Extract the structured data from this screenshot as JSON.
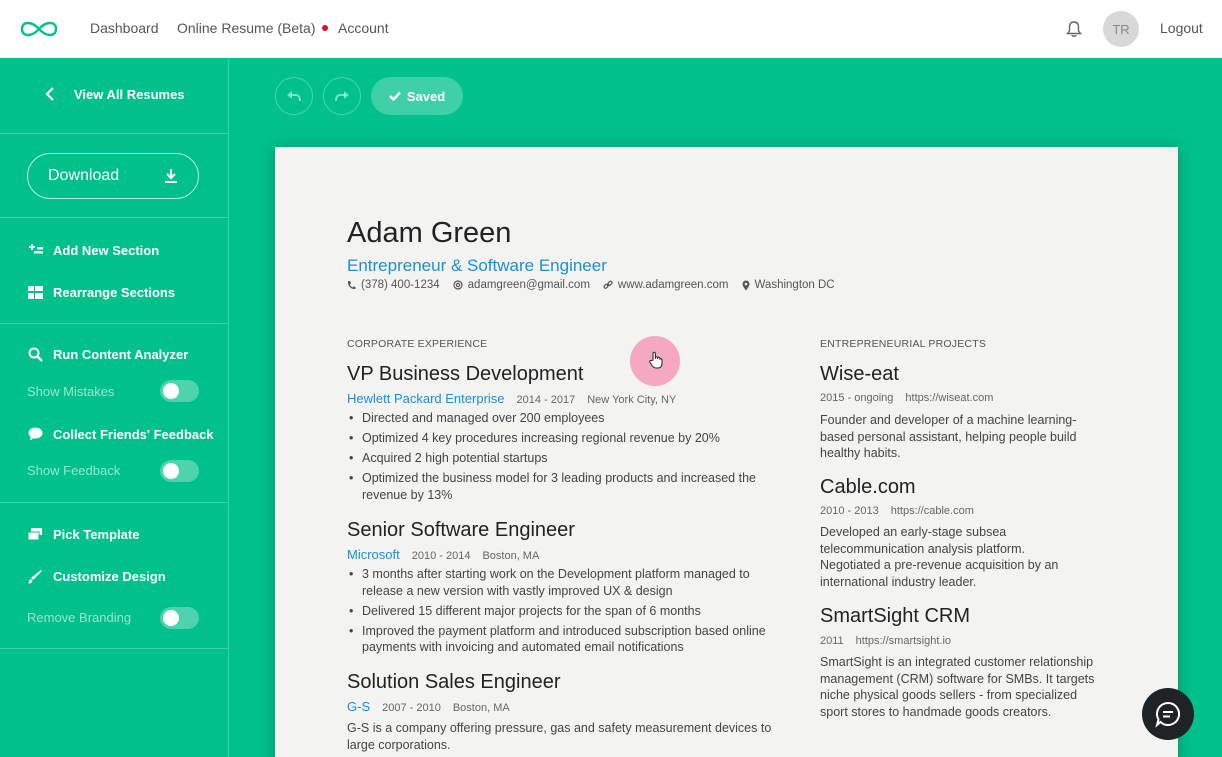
{
  "nav": {
    "dashboard": "Dashboard",
    "online_resume": "Online Resume (Beta)",
    "account": "Account",
    "avatar_initials": "TR",
    "logout": "Logout"
  },
  "sidebar": {
    "view_all": "View All Resumes",
    "download": "Download",
    "add_section": "Add New Section",
    "rearrange": "Rearrange Sections",
    "run_analyzer": "Run Content Analyzer",
    "show_mistakes": "Show Mistakes",
    "collect_feedback": "Collect Friends' Feedback",
    "show_feedback": "Show Feedback",
    "pick_template": "Pick Template",
    "customize_design": "Customize Design",
    "remove_branding": "Remove Branding"
  },
  "toolbar": {
    "saved": "Saved"
  },
  "resume": {
    "name": "Adam Green",
    "title": "Entrepreneur & Software Engineer",
    "phone": "(378) 400-1234",
    "email": "adamgreen@gmail.com",
    "website": "www.adamgreen.com",
    "location": "Washington DC",
    "corporate_heading": "CORPORATE EXPERIENCE",
    "entrepreneurial_heading": "ENTREPRENEURIAL PROJECTS",
    "jobs": [
      {
        "title": "VP Business Development",
        "company": "Hewlett Packard Enterprise",
        "dates": "2014 - 2017",
        "location": "New York City, NY",
        "bullets": [
          "Directed and managed over 200 employees",
          "Optimized 4 key procedures increasing regional revenue by 20%",
          "Acquired 2 high potential startups",
          "Optimized the business model for 3 leading products and increased the revenue by 13%"
        ]
      },
      {
        "title": "Senior Software Engineer",
        "company": "Microsoft",
        "dates": "2010 - 2014",
        "location": "Boston, MA",
        "bullets": [
          "3 months after starting work on the Development platform managed to release a new version with vastly improved UX & design",
          "Delivered 15 different major projects for the span of 6 months",
          "Improved the payment platform and introduced subscription based online payments with invoicing and automated email notifications"
        ]
      },
      {
        "title": "Solution Sales Engineer",
        "company": "G-S",
        "dates": "2007 - 2010",
        "location": "Boston, MA",
        "description": "G-S is a company offering pressure, gas and safety measurement devices to large corporations."
      }
    ],
    "projects": [
      {
        "title": "Wise-eat",
        "dates": "2015 - ongoing",
        "url": "https://wiseat.com",
        "description": "Founder and developer of a machine learning-based personal assistant, helping people build healthy habits."
      },
      {
        "title": "Cable.com",
        "dates": "2010 - 2013",
        "url": "https://cable.com",
        "description": "Developed an early-stage subsea telecommunication analysis platform. Negotiated a pre-revenue acquisition by an international industry leader."
      },
      {
        "title": "SmartSight CRM",
        "dates": "2011",
        "url": "https://smartsight.io",
        "description": "SmartSight is an integrated customer relationship management (CRM) software for SMBs. It targets niche physical goods sellers - from specialized sport stores to handmade goods creators."
      }
    ]
  },
  "colors": {
    "brand_green": "#00c08b",
    "link_blue": "#1a8fd6",
    "notification_red": "#e0102d"
  },
  "icons": [
    "logo-icon",
    "bell-icon",
    "chevron-left-icon",
    "download-icon",
    "add-section-icon",
    "rearrange-icon",
    "search-icon",
    "chat-bubble-icon",
    "template-icon",
    "brush-icon",
    "undo-icon",
    "redo-icon",
    "check-icon",
    "phone-icon",
    "at-icon",
    "link-icon",
    "location-pin-icon",
    "chat-icon"
  ]
}
